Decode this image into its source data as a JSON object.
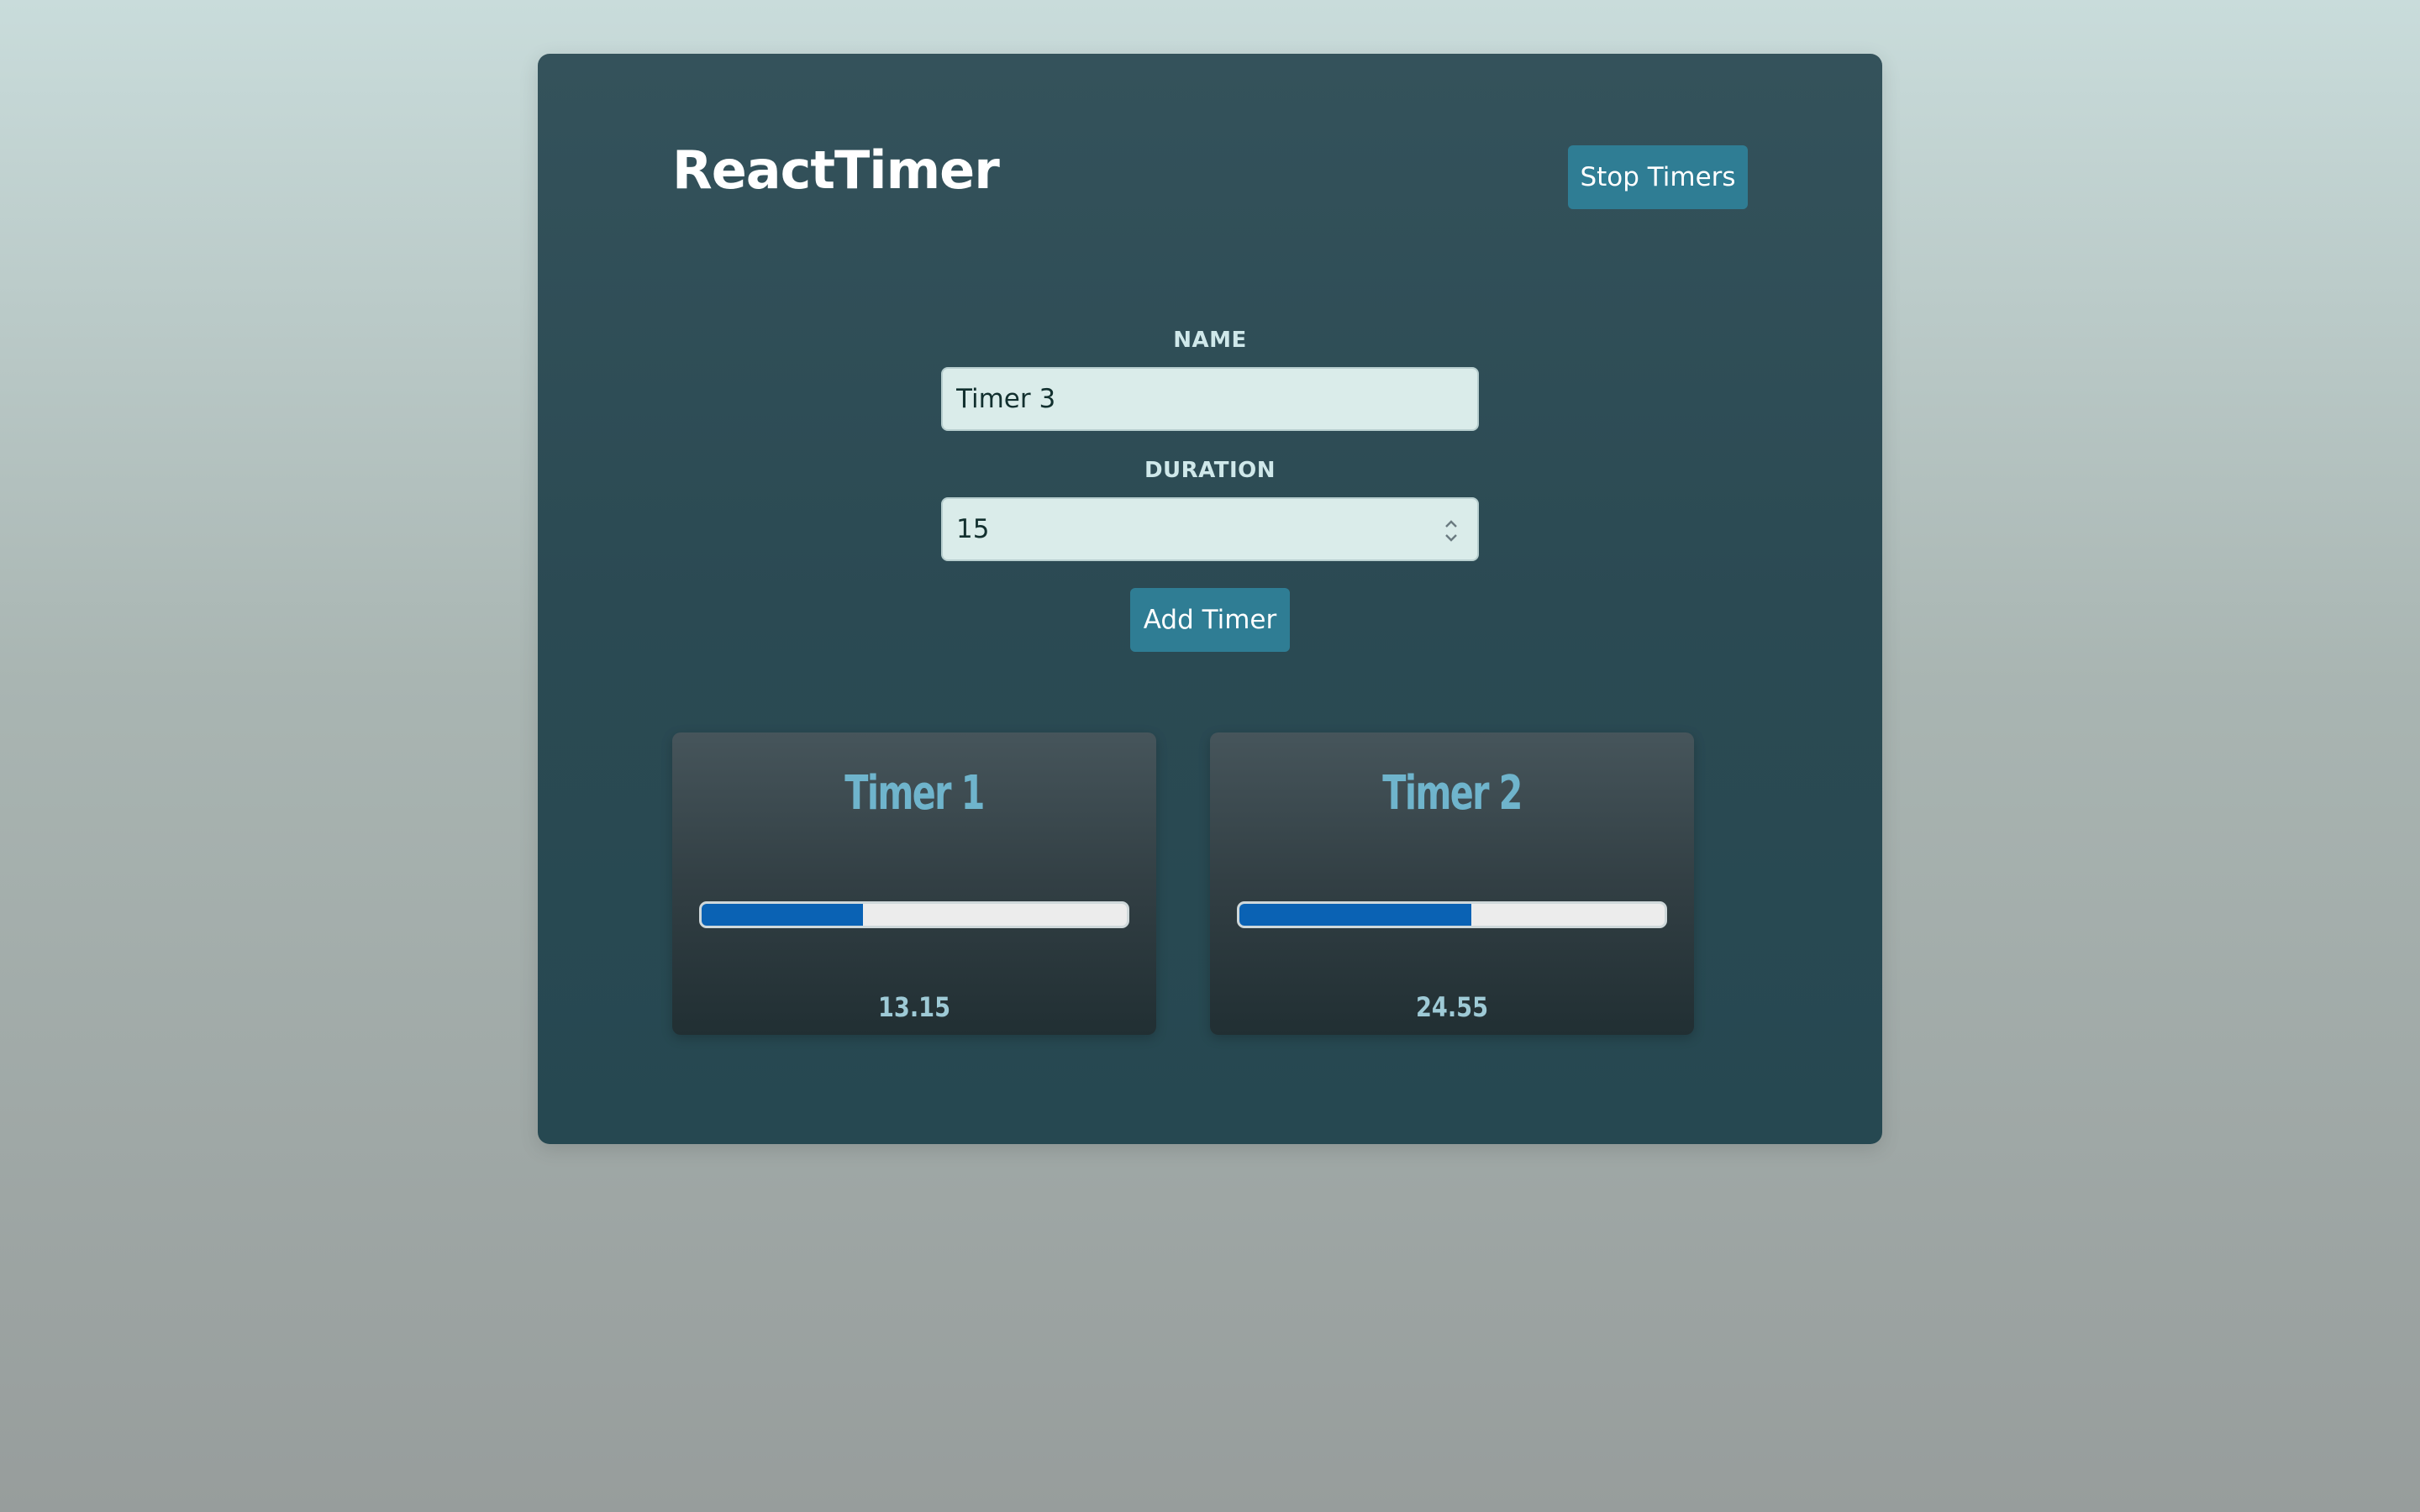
{
  "header": {
    "title": "ReactTimer",
    "stop_label": "Stop Timers"
  },
  "form": {
    "name_label": "NAME",
    "name_value": "Timer 3",
    "duration_label": "DURATION",
    "duration_value": "15",
    "add_label": "Add Timer"
  },
  "timers": [
    {
      "name": "Timer 1",
      "time": "13.15",
      "progress": 0.38
    },
    {
      "name": "Timer 2",
      "time": "24.55",
      "progress": 0.545
    }
  ],
  "colors": {
    "accent": "#2f7d94",
    "progress_fill": "#0a62b4",
    "timer_name": "#6fb4cc"
  },
  "icons": {
    "duration_spinner": "up-down-chevron-icon"
  }
}
